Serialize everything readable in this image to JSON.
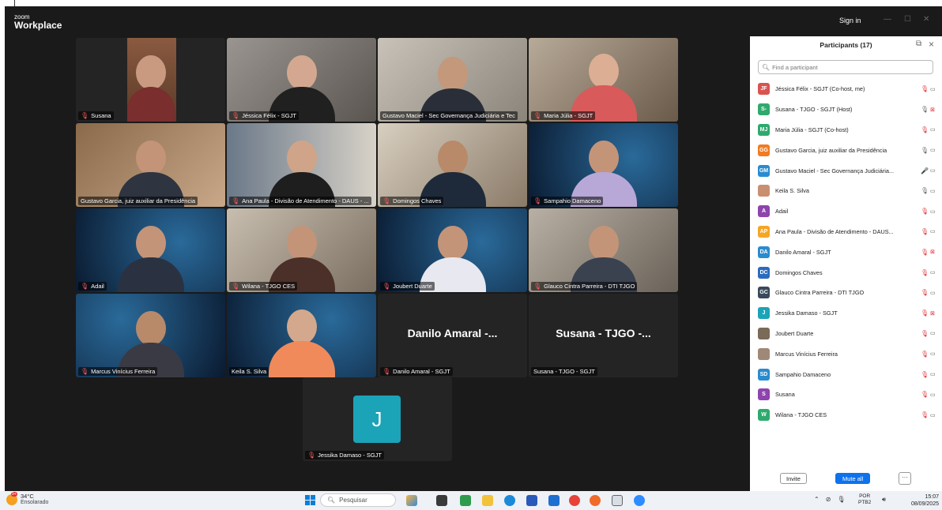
{
  "app": {
    "logo_top": "zoom",
    "logo_bottom": "Workplace",
    "sign_in": "Sign in",
    "minimize": "—",
    "maximize": "☐",
    "close": "✕"
  },
  "tiles": [
    {
      "name": "Susana",
      "muted": true
    },
    {
      "name": "Jéssica Félix - SGJT",
      "muted": true
    },
    {
      "name": "Gustavo Maciel - Sec Governança Judiciária e Tec",
      "muted": false
    },
    {
      "name": "Maria Júlia - SGJT",
      "muted": true
    },
    {
      "name": "Gustavo Garcia, juiz auxiliar da Presidência",
      "muted": false
    },
    {
      "name": "Ana Paula - Divisão de Atendimento - DAUS - ...",
      "muted": true
    },
    {
      "name": "Domingos Chaves",
      "muted": true
    },
    {
      "name": "Sampahio Damaceno",
      "muted": true
    },
    {
      "name": "Adail",
      "muted": true
    },
    {
      "name": "Wilana - TJGO CES",
      "muted": true
    },
    {
      "name": "Joubert Duarte",
      "muted": true
    },
    {
      "name": "Glauco Cintra Parreira - DTI TJGO",
      "muted": true
    },
    {
      "name": "Marcus Vinícius Ferreira",
      "muted": true
    },
    {
      "name": "Keila S. Silva",
      "muted": false
    },
    {
      "name": "Danilo Amaral - SGJT",
      "muted": true,
      "big": "Danilo Amaral -..."
    },
    {
      "name": "Susana - TJGO - SGJT",
      "muted": false,
      "big": "Susana - TJGO -..."
    },
    {
      "name": "Jessika Damaso - SGJT",
      "muted": true,
      "initial": "J"
    }
  ],
  "panel": {
    "title": "Participants (17)",
    "search_placeholder": "Find a participant",
    "invite": "Invite",
    "mute_all": "Mute all",
    "more": "···",
    "participants": [
      {
        "initials": "JF",
        "color": "#d9534f",
        "name": "Jéssica Félix - SGJT (Co-host, me)",
        "mic": "muted",
        "cam": "on"
      },
      {
        "initials": "S-",
        "color": "#2eaa6e",
        "name": "Susana - TJGO - SGJT (Host)",
        "mic": "on",
        "cam": "off"
      },
      {
        "initials": "MJ",
        "color": "#2eaa6e",
        "name": "Maria Júlia - SGJT (Co-host)",
        "mic": "muted",
        "cam": "on"
      },
      {
        "initials": "GG",
        "color": "#f07b22",
        "name": "Gustavo Garcia, juiz auxiliar da Presidência",
        "mic": "on",
        "cam": "on"
      },
      {
        "initials": "GM",
        "color": "#2a8bcf",
        "name": "Gustavo Maciel - Sec Governança Judiciária...",
        "mic": "talking",
        "cam": "on"
      },
      {
        "initials": "",
        "color": "#c89070",
        "name": "Keila S. Silva",
        "mic": "on",
        "cam": "on"
      },
      {
        "initials": "A",
        "color": "#8e44ad",
        "name": "Adail",
        "mic": "muted",
        "cam": "on"
      },
      {
        "initials": "AP",
        "color": "#f5a623",
        "name": "Ana Paula - Divisão de Atendimento - DAUS...",
        "mic": "muted",
        "cam": "on"
      },
      {
        "initials": "DA",
        "color": "#2a8bcf",
        "name": "Danilo Amaral - SGJT",
        "mic": "muted",
        "cam": "off"
      },
      {
        "initials": "DC",
        "color": "#2a6bbf",
        "name": "Domingos Chaves",
        "mic": "muted",
        "cam": "on"
      },
      {
        "initials": "GC",
        "color": "#3a4a5c",
        "name": "Glauco Cintra Parreira - DTI TJGO",
        "mic": "muted",
        "cam": "on"
      },
      {
        "initials": "J",
        "color": "#1ba3b8",
        "name": "Jessika Damaso - SGJT",
        "mic": "muted",
        "cam": "off"
      },
      {
        "initials": "",
        "color": "#7a6a58",
        "name": "Joubert Duarte",
        "mic": "muted",
        "cam": "on"
      },
      {
        "initials": "",
        "color": "#a08878",
        "name": "Marcus Vinícius Ferreira",
        "mic": "muted",
        "cam": "on"
      },
      {
        "initials": "SD",
        "color": "#2a8bcf",
        "name": "Sampahio Damaceno",
        "mic": "muted",
        "cam": "on"
      },
      {
        "initials": "S",
        "color": "#8e44ad",
        "name": "Susana",
        "mic": "muted",
        "cam": "on"
      },
      {
        "initials": "W",
        "color": "#2eaa6e",
        "name": "Wilana - TJGO CES",
        "mic": "muted",
        "cam": "on"
      }
    ]
  },
  "taskbar": {
    "weather_badge": "9+",
    "temperature": "34°C",
    "condition": "Ensolarado",
    "search": "Pesquisar",
    "lang_top": "POR",
    "lang_bottom": "PTB2",
    "time": "15:07",
    "date": "08/09/2025"
  }
}
